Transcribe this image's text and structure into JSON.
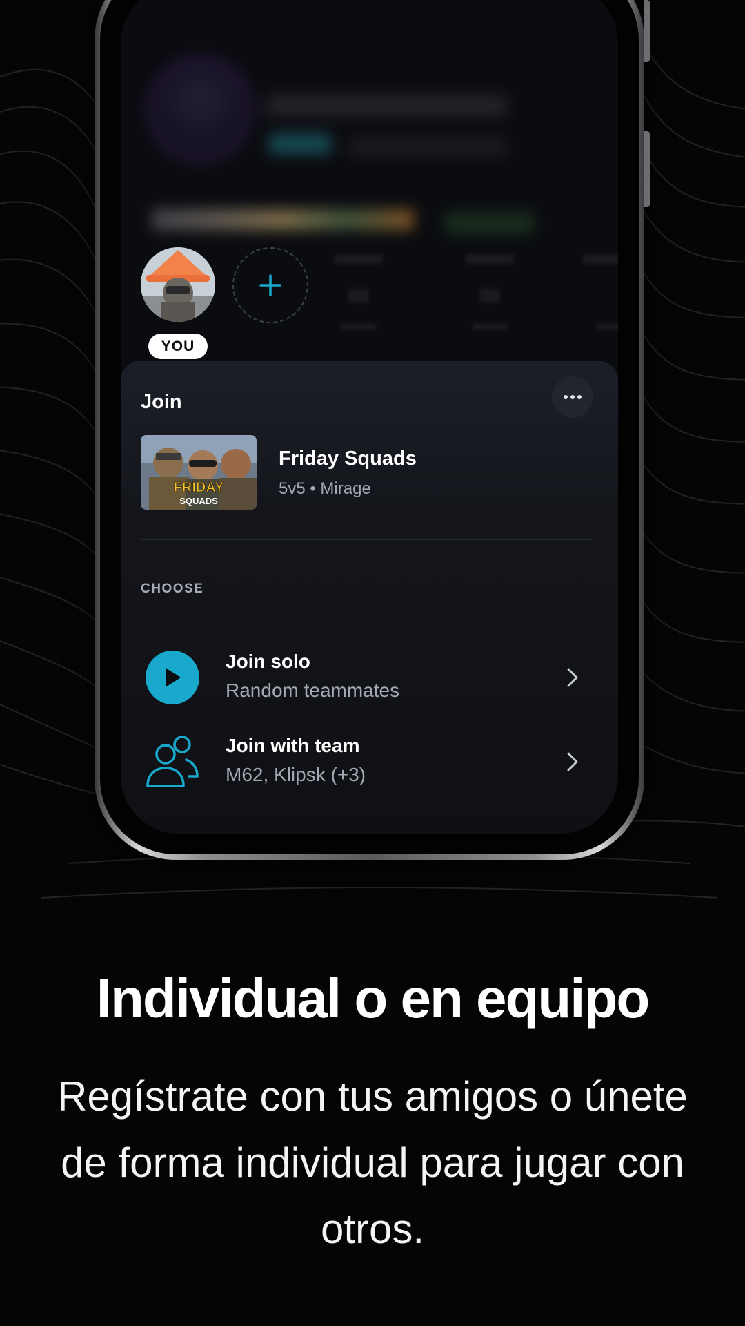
{
  "caption": {
    "headline": "Individual o en equipo",
    "subline": "Regístrate con tus amigos o únete de forma individual para jugar con otros."
  },
  "team": {
    "you_badge": "YOU",
    "add_icon": "plus-icon"
  },
  "sheet": {
    "title": "Join",
    "more_icon": "more-horizontal-icon",
    "event": {
      "name": "Friday Squads",
      "subtitle": "5v5 • Mirage",
      "thumb_text_top": "FRIDAY",
      "thumb_text_bottom": "SQUADS"
    },
    "choose_label": "CHOOSE",
    "options": [
      {
        "title": "Join solo",
        "subtitle": "Random teammates",
        "icon": "play-icon"
      },
      {
        "title": "Join with team",
        "subtitle": "M62, Klipsk (+3)",
        "icon": "users-icon"
      }
    ]
  },
  "colors": {
    "accent": "#19a9cc",
    "background": "#050505",
    "sheet": "#14161c"
  }
}
